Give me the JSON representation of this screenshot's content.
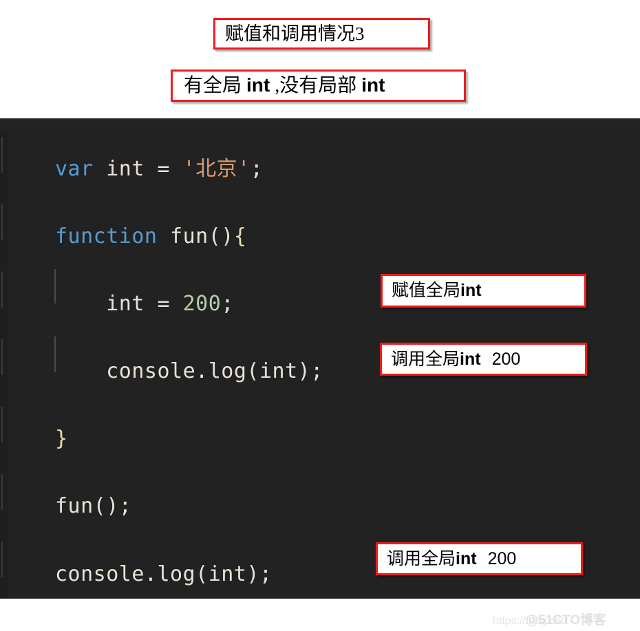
{
  "slide": {
    "title_box_1": "赋值和调用情况3",
    "title_box_2_cjk_1": "有全局 ",
    "title_box_2_lat_1": "int",
    "title_box_2_cjk_2": " ,没有局部 ",
    "title_box_2_lat_2": "int"
  },
  "code": {
    "language": "javascript",
    "theme": "dark",
    "lines": [
      {
        "kw": "var",
        "rest": " int = ",
        "str": "'北京'",
        "tail": ";"
      },
      {
        "kw": "function",
        "rest": " fun()",
        "brace": "{"
      },
      {
        "indent": "    ",
        "rest": "int = ",
        "num": "200",
        "tail": ";"
      },
      {
        "indent": "    ",
        "rest": "console.log(int);"
      },
      {
        "brace": "}"
      },
      {
        "rest": "fun();"
      },
      {
        "rest": "console.log(int);"
      }
    ],
    "full_text": "var int = '北京';\n\nfunction fun(){\n\n    int = 200;\n\n    console.log(int);\n\n}\n\nfun();\n\nconsole.log(int);"
  },
  "annotations": {
    "assign_global": {
      "cjk": "赋值全局",
      "lat": "int",
      "value": ""
    },
    "call_global_inner": {
      "cjk": "调用全局",
      "lat": "int",
      "value": "200"
    },
    "call_global_outer": {
      "cjk": "调用全局",
      "lat": "int",
      "value": "200"
    }
  },
  "watermark": {
    "url": "https://blog.csd",
    "brand": "@51CTO博客"
  },
  "colors": {
    "callout_border": "#ee1c1c",
    "editor_background": "#222222",
    "keyword": "#569cd6",
    "string": "#d99a72",
    "number": "#b5cea8",
    "plain_text": "#e8e2d8",
    "bracket": "#e8dcb0"
  }
}
